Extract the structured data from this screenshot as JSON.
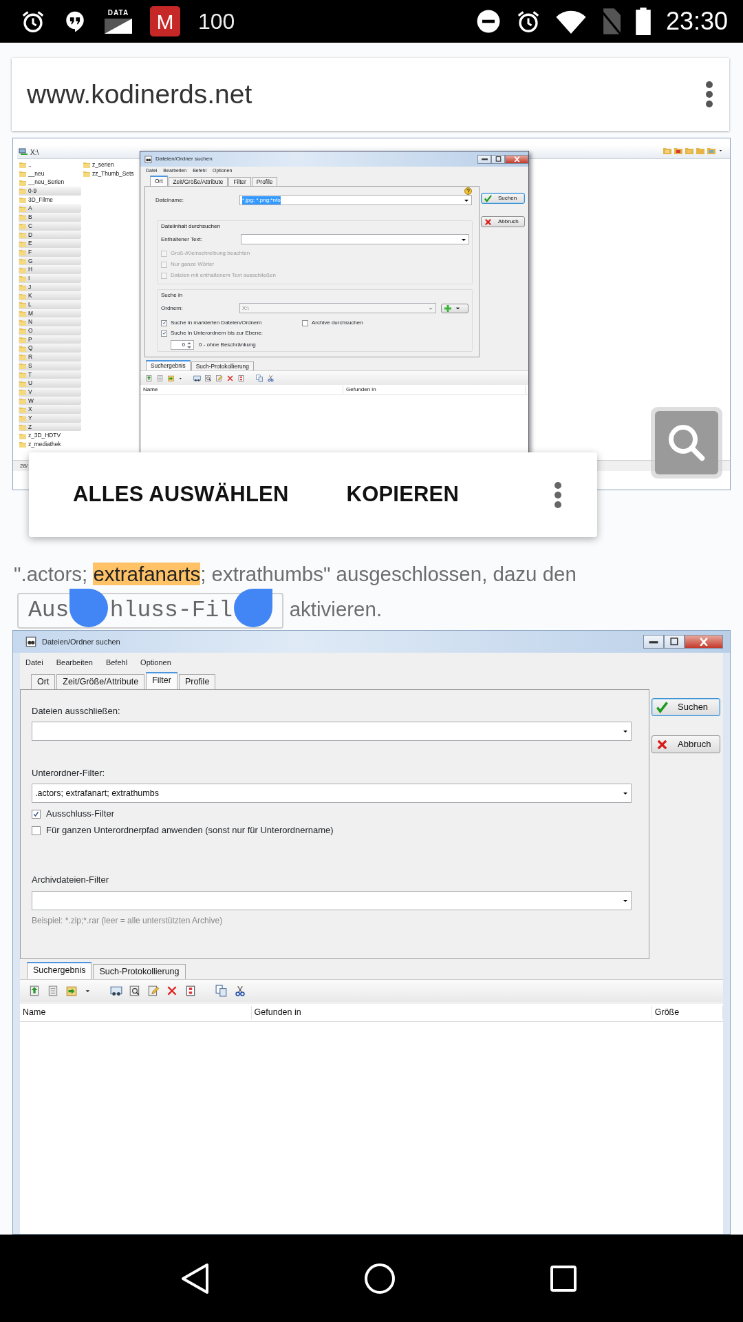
{
  "status_bar": {
    "data_label": "DATA",
    "app_icon_letter": "M",
    "notification_count": "100",
    "time": "23:30"
  },
  "address_bar": {
    "url": "www.kodinerds.net"
  },
  "screenshot_1": {
    "explorer": {
      "path": "X:\\",
      "folders": [
        {
          "name": "..",
          "selected": false
        },
        {
          "name": "__neu",
          "selected": false
        },
        {
          "name": "__neu_Serien",
          "selected": false
        },
        {
          "name": "0-9",
          "selected": true
        },
        {
          "name": "3D_Filme",
          "selected": false
        },
        {
          "name": "A",
          "selected": true
        },
        {
          "name": "B",
          "selected": true
        },
        {
          "name": "C",
          "selected": true
        },
        {
          "name": "D",
          "selected": true
        },
        {
          "name": "E",
          "selected": true
        },
        {
          "name": "F",
          "selected": true
        },
        {
          "name": "G",
          "selected": true
        },
        {
          "name": "H",
          "selected": true
        },
        {
          "name": "I",
          "selected": true
        },
        {
          "name": "J",
          "selected": true
        },
        {
          "name": "K",
          "selected": true
        },
        {
          "name": "L",
          "selected": true
        },
        {
          "name": "M",
          "selected": true
        },
        {
          "name": "N",
          "selected": true
        },
        {
          "name": "O",
          "selected": true
        },
        {
          "name": "P",
          "selected": true
        },
        {
          "name": "Q",
          "selected": true
        },
        {
          "name": "R",
          "selected": true
        },
        {
          "name": "S",
          "selected": true
        },
        {
          "name": "T",
          "selected": true
        },
        {
          "name": "U",
          "selected": true
        },
        {
          "name": "V",
          "selected": true
        },
        {
          "name": "W",
          "selected": true
        },
        {
          "name": "X",
          "selected": true
        },
        {
          "name": "Y",
          "selected": true
        },
        {
          "name": "Z",
          "selected": true
        },
        {
          "name": "z_3D_HDTV",
          "selected": false
        },
        {
          "name": "z_mediathek",
          "selected": false
        }
      ],
      "folders_column_2": [
        {
          "name": "z_serien",
          "selected": false
        },
        {
          "name": "zz_Thumb_Sets",
          "selected": false
        }
      ],
      "status": "28/"
    },
    "dialog": {
      "title": "Dateien/Ordner suchen",
      "menu": [
        "Datei",
        "Bearbeiten",
        "Befehl",
        "Optionen"
      ],
      "tabs": [
        {
          "label": "Ort",
          "selected": true
        },
        {
          "label": "Zeit/Größe/Attribute",
          "selected": false
        },
        {
          "label": "Filter",
          "selected": false
        },
        {
          "label": "Profile",
          "selected": false
        }
      ],
      "filename_label": "Dateiname:",
      "filename_value": "*.jpg; *.png;*nfo",
      "filename_value_selected": true,
      "content_group": "Dateiinhalt durchsuchen",
      "text_label": "Enthaltener Text:",
      "content_options": [
        {
          "label": "Groß-/Kleinschreibung beachten",
          "checked": false,
          "disabled": true
        },
        {
          "label": "Nur ganze Wörter",
          "checked": false,
          "disabled": true
        },
        {
          "label": "Dateien mit enthaltenem Text ausschließen",
          "checked": false,
          "disabled": true
        }
      ],
      "search_group": "Suche in",
      "folder_label": "Ordnern:",
      "folder_value": "X:\\",
      "search_options": [
        {
          "label": "Suche in markierten Dateien/Ordnern",
          "checked": true,
          "disabled": false
        },
        {
          "label": "Archive durchsuchen",
          "checked": false,
          "disabled": false
        },
        {
          "label": "Suche in Unterordnern bis zur Ebene:",
          "checked": true,
          "disabled": false
        }
      ],
      "depth_value": "0",
      "depth_hint": "0 - ohne Beschränkung",
      "buttons": [
        "Suchen",
        "Abbruch"
      ],
      "result_tabs": [
        {
          "label": "Suchergebnis",
          "selected": true
        },
        {
          "label": "Such-Protokollierung",
          "selected": false
        }
      ],
      "columns": [
        "Name",
        "Gefunden in"
      ]
    }
  },
  "selection_menu": {
    "items": [
      {
        "label": "ALLES AUSWÄHLEN"
      },
      {
        "label": "KOPIEREN"
      }
    ]
  },
  "paragraph": {
    "segments": [
      {
        "kind": "text",
        "text": "\".actors; ",
        "selected": false
      },
      {
        "kind": "text",
        "text": "extrafanarts",
        "selected": true
      },
      {
        "kind": "text",
        "text": "; extrathumbs\" ausgeschlossen, dazu den\n",
        "selected": false
      },
      {
        "kind": "code",
        "visible_parts": [
          "Aus",
          "hluss-Fil"
        ],
        "selected": false
      },
      {
        "kind": "text",
        "text": " aktivieren.",
        "selected": false
      }
    ]
  },
  "screenshot_2": {
    "dialog": {
      "title": "Dateien/Ordner suchen",
      "menu": [
        "Datei",
        "Bearbeiten",
        "Befehl",
        "Optionen"
      ],
      "tabs": [
        {
          "label": "Ort",
          "selected": false
        },
        {
          "label": "Zeit/Größe/Attribute",
          "selected": false
        },
        {
          "label": "Filter",
          "selected": true
        },
        {
          "label": "Profile",
          "selected": false
        }
      ],
      "sections": [
        {
          "label": "Dateien ausschließen:"
        },
        {
          "label": "Unterordner-Filter:",
          "value": ".actors; extrafanart; extrathumbs",
          "options": [
            {
              "label": "Ausschluss-Filter",
              "checked": true
            },
            {
              "label": "Für ganzen Unterordnerpfad anwenden (sonst nur für Unterordnername)",
              "checked": false
            }
          ]
        },
        {
          "label": "Archivdateien-Filter",
          "hint": "Beispiel: *.zip;*.rar (leer =  alle unterstützten Archive)"
        }
      ],
      "buttons": [
        "Suchen",
        "Abbruch"
      ],
      "result_tabs": [
        {
          "label": "Suchergebnis",
          "selected": true
        },
        {
          "label": "Such-Protokollierung",
          "selected": false
        }
      ],
      "columns": [
        "Name",
        "Gefunden in",
        "Größe"
      ]
    }
  }
}
